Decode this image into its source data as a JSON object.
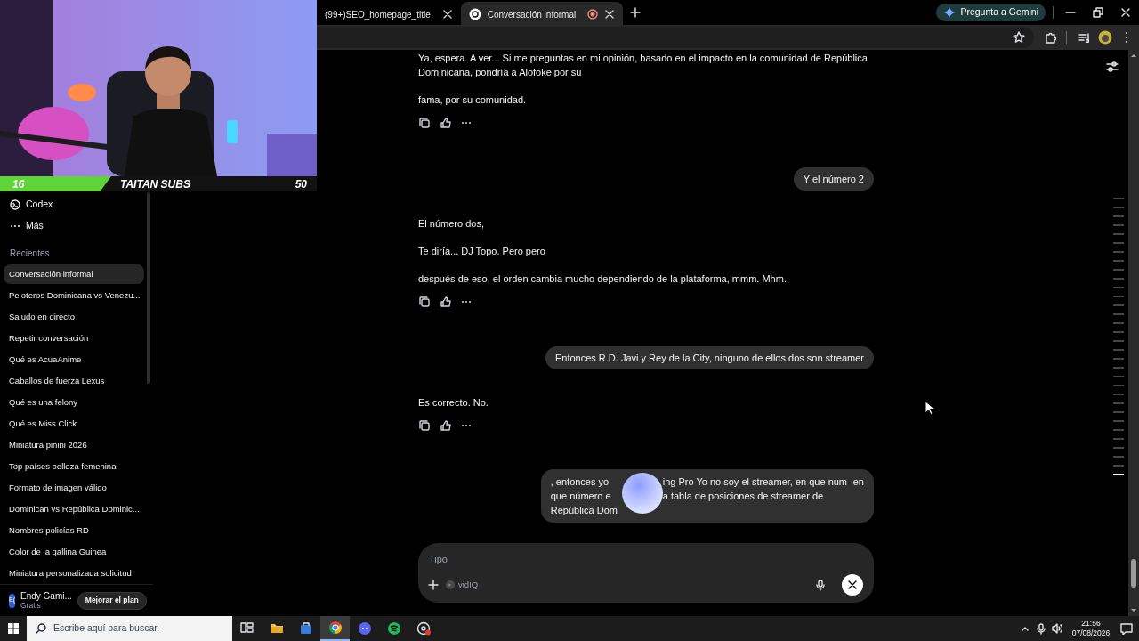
{
  "webcam": {
    "left_badge": "16",
    "title": "TAITAN SUBS",
    "right_badge": "50"
  },
  "browser": {
    "tabs": [
      {
        "title": "(99+)SEO_homepage_title",
        "selected": false,
        "favicon": false,
        "recording": false
      },
      {
        "title": "Conversación informal",
        "selected": true,
        "favicon": true,
        "recording": true
      }
    ],
    "gemini_button": "Pregunta a Gemini"
  },
  "sidebar": {
    "items": [
      {
        "label": "Codex",
        "kind": "codex"
      },
      {
        "label": "Más",
        "kind": "more"
      }
    ],
    "section": "Recientes",
    "chats": [
      {
        "label": "Conversación informal",
        "selected": true
      },
      {
        "label": "Peloteros Dominicana vs Venezu...",
        "selected": false
      },
      {
        "label": "Saludo en directo",
        "selected": false
      },
      {
        "label": "Repetir conversación",
        "selected": false
      },
      {
        "label": "Qué es AcuaAnime",
        "selected": false
      },
      {
        "label": "Caballos de fuerza Lexus",
        "selected": false
      },
      {
        "label": "Qué es una felony",
        "selected": false
      },
      {
        "label": "Qué es Miss Click",
        "selected": false
      },
      {
        "label": "Miniatura pinini 2026",
        "selected": false
      },
      {
        "label": "Top países belleza femenina",
        "selected": false
      },
      {
        "label": "Formato de imagen válido",
        "selected": false
      },
      {
        "label": "Dominican vs República Dominic...",
        "selected": false
      },
      {
        "label": "Nombres policías RD",
        "selected": false
      },
      {
        "label": "Color de la gallina Guinea",
        "selected": false
      },
      {
        "label": "Miniatura personalizada solicitud",
        "selected": false
      }
    ],
    "user": {
      "initials": "E(",
      "name": "Endy Gami...",
      "plan": "Gratis"
    },
    "upgrade_button": "Mejorar el plan"
  },
  "messages": [
    {
      "kind": "assistant",
      "paragraphs": [
        "Ya, espera. A ver... Si me preguntas en mi opinión, basado en el impacto en la comunidad de República Dominicana, pondría a Alofoke por su",
        "fama, por su comunidad."
      ]
    },
    {
      "kind": "user",
      "text": "Y el número 2"
    },
    {
      "kind": "assistant",
      "paragraphs": [
        "El número dos,",
        "Te diría... DJ Topo. Pero pero",
        "después de eso, el orden cambia mucho dependiendo de la plataforma, mmm. Mhm."
      ]
    },
    {
      "kind": "user",
      "text": "Entonces R.D. Javi y Rey de la City, ninguno de ellos dos son streamer"
    },
    {
      "kind": "assistant",
      "paragraphs": [
        "Es correcto. No."
      ]
    },
    {
      "kind": "user_covered",
      "lines": [
        {
          "before": ", entonces yo",
          "after": "ing Pro Yo no soy el streamer, en que num- en"
        },
        {
          "before": "que número e",
          "after": "a tabla de posiciones de streamer de"
        },
        {
          "before": "República Dom"
        }
      ]
    }
  ],
  "composer": {
    "placeholder": "Tipo",
    "tool": "vidIQ"
  },
  "taskbar": {
    "search_placeholder": "Escribe aquí para buscar.",
    "apps": [
      {
        "kind": "task-view",
        "selected": false
      },
      {
        "kind": "files",
        "selected": false
      },
      {
        "kind": "store",
        "selected": false
      },
      {
        "kind": "chrome",
        "selected": true
      },
      {
        "kind": "chat",
        "selected": false
      },
      {
        "kind": "music",
        "selected": false
      },
      {
        "kind": "recorder",
        "selected": false
      }
    ],
    "time": "21:56",
    "date": "07/08/2026"
  }
}
